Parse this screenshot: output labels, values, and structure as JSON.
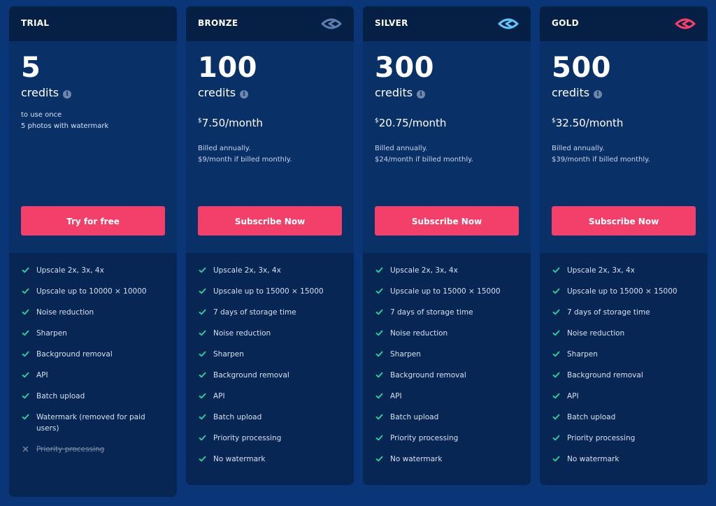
{
  "plans": [
    {
      "name": "TRIAL",
      "credits": "5",
      "credits_label": "credits",
      "info_glyph": "i",
      "note_lines": [
        "to use once",
        "5 photos with watermark"
      ],
      "cta": "Try for free",
      "features": [
        {
          "text": "Upscale 2x, 3x, 4x",
          "enabled": true
        },
        {
          "text": "Upscale up to 10000 × 10000",
          "enabled": true
        },
        {
          "text": "Noise reduction",
          "enabled": true
        },
        {
          "text": "Sharpen",
          "enabled": true
        },
        {
          "text": "Background removal",
          "enabled": true
        },
        {
          "text": "API",
          "enabled": true
        },
        {
          "text": "Batch upload",
          "enabled": true
        },
        {
          "text": "Watermark (removed for paid users)",
          "enabled": true
        },
        {
          "text": "Priority processing",
          "enabled": false
        }
      ]
    },
    {
      "name": "BRONZE",
      "logo_icon": "eye-logo-icon",
      "logo_color": "#5b7fae",
      "credits": "100",
      "credits_label": "credits",
      "info_glyph": "i",
      "price_currency": "$",
      "price_amount": "7.50/month",
      "billing_lines": [
        "Billed annually.",
        "$9/month if billed monthly."
      ],
      "cta": "Subscribe Now",
      "features": [
        {
          "text": "Upscale 2x, 3x, 4x",
          "enabled": true
        },
        {
          "text": "Upscale up to 15000 × 15000",
          "enabled": true
        },
        {
          "text": "7 days of storage time",
          "enabled": true
        },
        {
          "text": "Noise reduction",
          "enabled": true
        },
        {
          "text": "Sharpen",
          "enabled": true
        },
        {
          "text": "Background removal",
          "enabled": true
        },
        {
          "text": "API",
          "enabled": true
        },
        {
          "text": "Batch upload",
          "enabled": true
        },
        {
          "text": "Priority processing",
          "enabled": true
        },
        {
          "text": "No watermark",
          "enabled": true
        }
      ]
    },
    {
      "name": "SILVER",
      "logo_icon": "eye-logo-icon",
      "logo_color": "#62c3f5",
      "credits": "300",
      "credits_label": "credits",
      "info_glyph": "i",
      "price_currency": "$",
      "price_amount": "20.75/month",
      "billing_lines": [
        "Billed annually.",
        "$24/month if billed monthly."
      ],
      "cta": "Subscribe Now",
      "features": [
        {
          "text": "Upscale 2x, 3x, 4x",
          "enabled": true
        },
        {
          "text": "Upscale up to 15000 × 15000",
          "enabled": true
        },
        {
          "text": "7 days of storage time",
          "enabled": true
        },
        {
          "text": "Noise reduction",
          "enabled": true
        },
        {
          "text": "Sharpen",
          "enabled": true
        },
        {
          "text": "Background removal",
          "enabled": true
        },
        {
          "text": "API",
          "enabled": true
        },
        {
          "text": "Batch upload",
          "enabled": true
        },
        {
          "text": "Priority processing",
          "enabled": true
        },
        {
          "text": "No watermark",
          "enabled": true
        }
      ]
    },
    {
      "name": "GOLD",
      "logo_icon": "eye-logo-icon",
      "logo_color": "#f2406a",
      "credits": "500",
      "credits_label": "credits",
      "info_glyph": "i",
      "price_currency": "$",
      "price_amount": "32.50/month",
      "billing_lines": [
        "Billed annually.",
        "$39/month if billed monthly."
      ],
      "cta": "Subscribe Now",
      "features": [
        {
          "text": "Upscale 2x, 3x, 4x",
          "enabled": true
        },
        {
          "text": "Upscale up to 15000 × 15000",
          "enabled": true
        },
        {
          "text": "7 days of storage time",
          "enabled": true
        },
        {
          "text": "Noise reduction",
          "enabled": true
        },
        {
          "text": "Sharpen",
          "enabled": true
        },
        {
          "text": "Background removal",
          "enabled": true
        },
        {
          "text": "API",
          "enabled": true
        },
        {
          "text": "Batch upload",
          "enabled": true
        },
        {
          "text": "Priority processing",
          "enabled": true
        },
        {
          "text": "No watermark",
          "enabled": true
        }
      ]
    }
  ],
  "colors": {
    "page_bg": "#0a3577",
    "card_top_bg": "#0a3068",
    "card_head_bg": "#061f45",
    "card_features_bg": "#072654",
    "cta_bg": "#f2406a",
    "check": "#2fd6a0",
    "cross": "#7a8ba8"
  }
}
